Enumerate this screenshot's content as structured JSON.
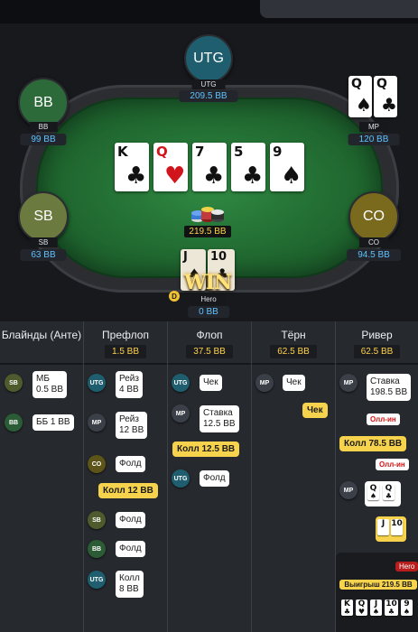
{
  "seats": {
    "utg": {
      "label": "UTG",
      "name": "UTG",
      "stack": "209.5 BB",
      "color": "#1f5e6e"
    },
    "bb": {
      "label": "BB",
      "name": "BB",
      "stack": "99 BB",
      "color": "#2c6a39"
    },
    "mp": {
      "name": "MP",
      "stack": "120 BB",
      "cards": [
        {
          "rank": "Q",
          "suit": "♠"
        },
        {
          "rank": "Q",
          "suit": "♣"
        }
      ]
    },
    "sb": {
      "label": "SB",
      "name": "SB",
      "stack": "63 BB",
      "color": "#6b7a3e"
    },
    "co": {
      "label": "CO",
      "name": "CO",
      "stack": "94.5 BB",
      "color": "#7a6a1e"
    },
    "hero": {
      "name": "Hero",
      "stack": "0 BB",
      "cards": [
        {
          "rank": "J",
          "suit": "♠"
        },
        {
          "rank": "10",
          "suit": "♣"
        }
      ]
    }
  },
  "board": [
    {
      "rank": "K",
      "suit": "♣",
      "red": false
    },
    {
      "rank": "Q",
      "suit": "♥",
      "red": true
    },
    {
      "rank": "7",
      "suit": "♣",
      "red": false
    },
    {
      "rank": "5",
      "suit": "♣",
      "red": false
    },
    {
      "rank": "9",
      "suit": "♠",
      "red": false
    }
  ],
  "pot": "219.5 BB",
  "win_badge": "WIN",
  "dealer_button": "D",
  "streets": [
    {
      "title": "Блайнды (Анте)",
      "amount": ""
    },
    {
      "title": "Префлоп",
      "amount": "1.5 BB"
    },
    {
      "title": "Флоп",
      "amount": "37.5 BB"
    },
    {
      "title": "Тёрн",
      "amount": "62.5 BB"
    },
    {
      "title": "Ривер",
      "amount": "62.5 BB"
    }
  ],
  "actions": {
    "blinds": [
      {
        "pos": "SB",
        "text": "МБ\n0.5 BB"
      },
      {
        "pos": "BB",
        "text": "ББ 1 BB"
      }
    ],
    "preflop": [
      {
        "pos": "UTG",
        "text": "Рейз\n4 BB"
      },
      {
        "pos": "MP",
        "text": "Рейз\n12 BB"
      },
      {
        "pos": "CO",
        "text": "Фолд"
      },
      {
        "hero": true,
        "text": "Колл 12 BB"
      },
      {
        "pos": "SB",
        "text": "Фолд"
      },
      {
        "pos": "BB",
        "text": "Фолд"
      },
      {
        "pos": "UTG",
        "text": "Колл\n8 BB"
      }
    ],
    "flop": [
      {
        "pos": "UTG",
        "text": "Чек"
      },
      {
        "pos": "MP",
        "text": "Ставка\n12.5 BB"
      },
      {
        "hero": true,
        "text": "Колл 12.5 BB"
      },
      {
        "pos": "UTG",
        "text": "Фолд"
      }
    ],
    "turn": [
      {
        "pos": "MP",
        "text": "Чек"
      },
      {
        "hero": true,
        "text": "Чек"
      }
    ],
    "river": [
      {
        "pos": "MP",
        "text": "Ставка\n198.5 BB"
      },
      {
        "tag": "Олл-ин"
      },
      {
        "hero": true,
        "text": "Колл 78.5 BB"
      },
      {
        "tag": "Олл-ин"
      },
      {
        "pos": "MP",
        "show": true
      },
      {
        "hero": true,
        "show": true
      }
    ]
  },
  "result": {
    "hero_label": "Hero",
    "win_text": "Выигрыш 219.5 BB",
    "win_cards": [
      {
        "rank": "K",
        "suit": "♣",
        "red": false
      },
      {
        "rank": "Q",
        "suit": "♥",
        "red": true
      },
      {
        "rank": "J",
        "suit": "♠",
        "red": false
      },
      {
        "rank": "10",
        "suit": "♣",
        "red": false
      },
      {
        "rank": "9",
        "suit": "♠",
        "red": false
      }
    ]
  },
  "colors": {
    "stack": "#5fc2ff",
    "pot": "#ffd24a",
    "felt": "#216a31",
    "hero_action": "#f7d34d",
    "allin": "#d21414"
  },
  "pos_colors": {
    "UTG": "#1f5e6e",
    "MP": "#3b4048",
    "CO": "#5c5418",
    "SB": "#4e5b2c",
    "BB": "#2c5c36"
  }
}
